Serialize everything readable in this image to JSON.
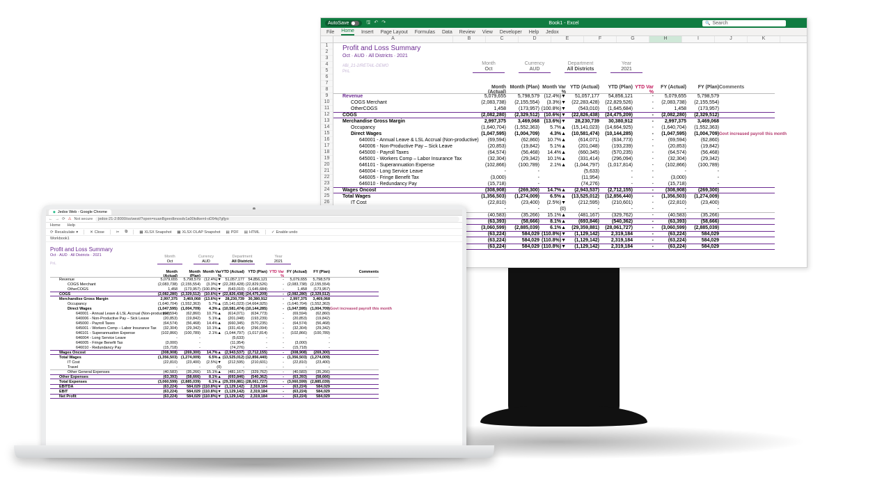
{
  "excel": {
    "titlebar": {
      "autosave": "AutoSave",
      "title": "Book1 - Excel",
      "search_placeholder": "Search"
    },
    "tabs": [
      "File",
      "Home",
      "Insert",
      "Page Layout",
      "Formulas",
      "Data",
      "Review",
      "View",
      "Developer",
      "Help",
      "Jedox"
    ],
    "cols": [
      "A",
      "B",
      "C",
      "D",
      "E",
      "F",
      "G",
      "H",
      "I",
      "J",
      "K"
    ],
    "active_col_index": 7,
    "row_start": 1,
    "row_end": 37
  },
  "report": {
    "title": "Profit and Loss Summary",
    "subtitle": "Oct · AUD · All Districts · 2021",
    "demo1": "#Bi_21-2/RETAIL-DEMO",
    "demo2": "PnL",
    "filters": [
      {
        "label": "Month",
        "value": "Oct"
      },
      {
        "label": "Currency",
        "value": "AUD"
      },
      {
        "label": "Department",
        "value": "All Districts",
        "bold": true
      },
      {
        "label": "Year",
        "value": "2021"
      }
    ],
    "columns": [
      "Month (Actual)",
      "Month (Plan)",
      "Month Var %",
      "YTD (Actual)",
      "YTD (Plan)",
      "YTD Var %",
      "FY (Actual)",
      "FY (Plan)",
      "Comments"
    ],
    "rows": [
      {
        "label": "Revenue",
        "indent": 0,
        "cells": [
          "5,079,655",
          "5,798,579",
          "(12.4%)▼",
          "51,057,177",
          "54,856,121",
          "-",
          "5,079,655",
          "5,798,579",
          ""
        ],
        "style": "thin purpletext"
      },
      {
        "label": "COGS Merchant",
        "indent": 1,
        "cells": [
          "(2,083,738)",
          "(2,155,554)",
          "(3.3%)▼",
          "(22,283,428)",
          "(22,829,526)",
          "-",
          "(2,083,738)",
          "(2,155,554)",
          ""
        ]
      },
      {
        "label": "OtherCOGS",
        "indent": 1,
        "cells": [
          "1,458",
          "(173,957)",
          "(100.8%)▼",
          "(543,010)",
          "(1,645,684)",
          "-",
          "1,458",
          "(173,957)",
          ""
        ]
      },
      {
        "label": "COGS",
        "indent": 0,
        "bold": true,
        "cells": [
          "(2,082,280)",
          "(2,329,512)",
          "(10.6%)▼",
          "(22,826,438)",
          "(24,475,209)",
          "-",
          "(2,082,280)",
          "(2,329,512)",
          ""
        ],
        "style": "sectionline"
      },
      {
        "label": "Merchandise Gross Margin",
        "indent": 0,
        "bold": true,
        "cells": [
          "2,997,375",
          "3,469,068",
          "(13.6%)▼",
          "28,230,739",
          "30,380,912",
          "-",
          "2,997,375",
          "3,469,068",
          ""
        ]
      },
      {
        "label": "Occupancy",
        "indent": 1,
        "cells": [
          "(1,640,704)",
          "(1,552,363)",
          "5.7%▲",
          "(15,141,023)",
          "(14,664,925)",
          "-",
          "(1,640,704)",
          "(1,552,363)",
          ""
        ]
      },
      {
        "label": "Direct Wages",
        "indent": 1,
        "bold": true,
        "cells": [
          "(1,047,595)",
          "(1,004,709)",
          "4.3%▲",
          "(10,581,474)",
          "(10,144,285)",
          "-",
          "(1,047,595)",
          "(1,004,709)",
          "Govt increased payroll this month"
        ]
      },
      {
        "label": "640001 - Annual Leave & LSL Accrual (Non-productive)",
        "indent": 2,
        "cells": [
          "(69,594)",
          "(62,860)",
          "10.7%▲",
          "(614,071)",
          "(634,773)",
          "-",
          "(69,594)",
          "(62,860)",
          ""
        ]
      },
      {
        "label": "640006 - Non-Productive Pay – Sick Leave",
        "indent": 2,
        "cells": [
          "(20,853)",
          "(19,842)",
          "5.1%▲",
          "(201,048)",
          "(193,239)",
          "-",
          "(20,853)",
          "(19,842)",
          ""
        ]
      },
      {
        "label": "645000 - Payroll Taxes",
        "indent": 2,
        "cells": [
          "(64,574)",
          "(56,468)",
          "14.4%▲",
          "(660,345)",
          "(570,235)",
          "-",
          "(64,574)",
          "(56,468)",
          ""
        ]
      },
      {
        "label": "645001 - Workers Comp – Labor Insurance Tax",
        "indent": 2,
        "cells": [
          "(32,304)",
          "(29,342)",
          "10.1%▲",
          "(331,414)",
          "(296,094)",
          "-",
          "(32,304)",
          "(29,342)",
          ""
        ]
      },
      {
        "label": "646101 - Superannuation Expense",
        "indent": 2,
        "cells": [
          "(102,866)",
          "(100,789)",
          "2.1%▲",
          "(1,044,797)",
          "(1,017,814)",
          "-",
          "(102,866)",
          "(100,789)",
          ""
        ]
      },
      {
        "label": "646004 - Long Service Leave",
        "indent": 2,
        "cells": [
          "-",
          "-",
          "",
          "(5,633)",
          "-",
          "-",
          "-",
          "-",
          ""
        ]
      },
      {
        "label": "646005 - Fringe Benefit Tax",
        "indent": 2,
        "cells": [
          "(3,000)",
          "-",
          "",
          "(11,954)",
          "-",
          "-",
          "(3,000)",
          "-",
          ""
        ]
      },
      {
        "label": "646010 - Redundancy Pay",
        "indent": 2,
        "cells": [
          "(15,718)",
          "-",
          "",
          "(74,276)",
          "-",
          "-",
          "(15,718)",
          "-",
          ""
        ]
      },
      {
        "label": "Wages Oncost",
        "indent": 0,
        "bold": true,
        "cells": [
          "(308,908)",
          "(269,300)",
          "14.7%▲",
          "(2,943,537)",
          "(2,712,155)",
          "-",
          "(308,908)",
          "(269,300)",
          ""
        ],
        "style": "sectionline"
      },
      {
        "label": "Total Wages",
        "indent": 0,
        "bold": true,
        "cells": [
          "(1,356,503)",
          "(1,274,009)",
          "6.5%▲",
          "(13,525,012)",
          "(12,856,440)",
          "-",
          "(1,356,503)",
          "(1,274,009)",
          ""
        ]
      },
      {
        "label": "IT Cost",
        "indent": 1,
        "cells": [
          "(22,810)",
          "(23,400)",
          "(2.5%)▼",
          "(212,595)",
          "(210,601)",
          "-",
          "(22,810)",
          "(23,400)",
          ""
        ]
      },
      {
        "label": "Travel",
        "indent": 1,
        "cells": [
          "-",
          "-",
          "(0)",
          "-",
          "-",
          "-",
          "-",
          "-",
          ""
        ]
      },
      {
        "label": "Other General Expenses",
        "indent": 1,
        "cells": [
          "(40,583)",
          "(35,266)",
          "15.1%▲",
          "(481,167)",
          "(329,762)",
          "-",
          "(40,583)",
          "(35,266)",
          ""
        ],
        "style": "thin"
      },
      {
        "label": "Other Expenses",
        "indent": 0,
        "bold": true,
        "cells": [
          "(63,393)",
          "(58,666)",
          "8.1%▲",
          "(693,846)",
          "(540,362)",
          "-",
          "(63,393)",
          "(58,666)",
          ""
        ],
        "style": "sectionline"
      },
      {
        "label": "Total Expenses",
        "indent": 0,
        "bold": true,
        "cells": [
          "(3,060,599)",
          "(2,885,039)",
          "6.1%▲",
          "(29,359,881)",
          "(28,061,727)",
          "-",
          "(3,060,599)",
          "(2,885,039)",
          ""
        ]
      },
      {
        "label": "EBITDA",
        "indent": 0,
        "bold": true,
        "cells": [
          "(63,224)",
          "584,029",
          "(110.8%)▼",
          "(1,129,142)",
          "2,319,184",
          "-",
          "(63,224)",
          "584,029",
          ""
        ],
        "style": "sectionline"
      },
      {
        "label": "EBIT",
        "indent": 0,
        "bold": true,
        "cells": [
          "(63,224)",
          "584,029",
          "(110.8%)▼",
          "(1,129,142)",
          "2,319,184",
          "-",
          "(63,224)",
          "584,029",
          ""
        ]
      },
      {
        "label": "Net Profit",
        "indent": 0,
        "bold": true,
        "cells": [
          "(63,224)",
          "584,029",
          "(110.8%)▼",
          "(1,129,142)",
          "2,319,184",
          "-",
          "(63,224)",
          "584,029",
          ""
        ],
        "style": "sectionline"
      }
    ]
  },
  "chrome": {
    "tab_title": "Jedox Web - Google Chrome",
    "security": "Not secure",
    "url": "jedox-21-2:8000/ss/west/?open=xuanBgeedbnosdv1a00kdkeml-oD94q7gfjyo",
    "menu": [
      "Home",
      "Help"
    ],
    "toolbar": {
      "recalc": "Recalculate",
      "close": "Close",
      "snap": "XLSX Snapshot",
      "olap": "XLSX OLAP Snapshot",
      "pdf": "PDF",
      "html": "HTML",
      "undo": "Enable undo"
    },
    "workbook": "Workbook1"
  }
}
